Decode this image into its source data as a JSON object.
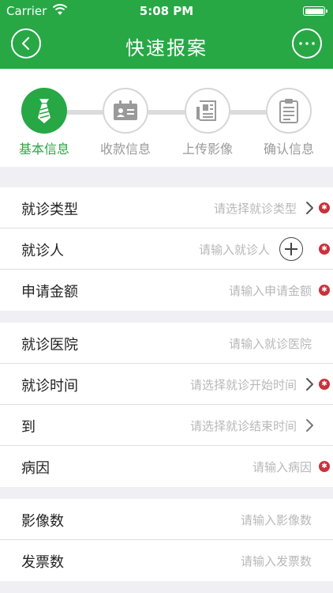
{
  "status_bar": {
    "carrier": "Carrier",
    "time": "5:08 PM"
  },
  "nav": {
    "title": "快速报案"
  },
  "steps": [
    {
      "label": "基本信息",
      "state": "active"
    },
    {
      "label": "收款信息",
      "state": "inactive"
    },
    {
      "label": "上传影像",
      "state": "inactive"
    },
    {
      "label": "确认信息",
      "state": "inactive"
    }
  ],
  "colors": {
    "accent": "#27a845",
    "required": "#c8323c",
    "placeholder": "#b8b8b8"
  },
  "form": {
    "group1": {
      "visit_type": {
        "label": "就诊类型",
        "placeholder": "请选择就诊类型",
        "required": true
      },
      "patient": {
        "label": "就诊人",
        "placeholder": "请输入就诊人",
        "required": true
      },
      "amount": {
        "label": "申请金额",
        "placeholder": "请输入申请金额",
        "required": true
      }
    },
    "group2": {
      "hospital": {
        "label": "就诊医院",
        "placeholder": "请输入就诊医院",
        "required": false
      },
      "visit_time": {
        "label": "就诊时间",
        "placeholder": "请选择就诊开始时间",
        "required": true
      },
      "to": {
        "label": "到",
        "placeholder": "请选择就诊结束时间",
        "required": false
      },
      "cause": {
        "label": "病因",
        "placeholder": "请输入病因",
        "required": true
      }
    },
    "group3": {
      "image_count": {
        "label": "影像数",
        "placeholder": "请输入影像数",
        "required": false
      },
      "invoice_count": {
        "label": "发票数",
        "placeholder": "请输入发票数",
        "required": false
      }
    }
  }
}
